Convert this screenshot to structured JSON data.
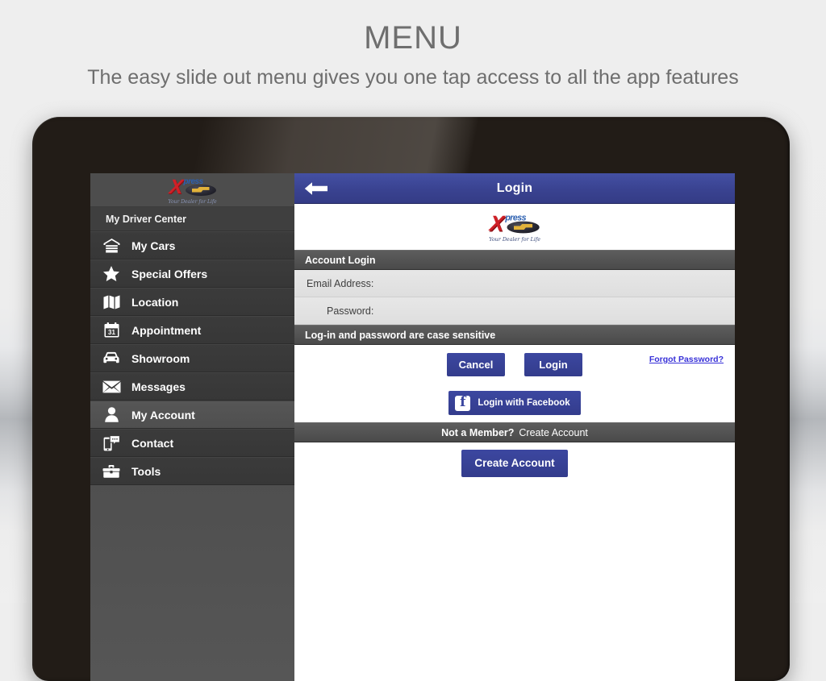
{
  "headline": {
    "title": "MENU",
    "subtitle": "The easy slide out menu gives you one tap access to all the app features"
  },
  "brand": {
    "logo_x": "X",
    "logo_word": "press",
    "logo_tagline": "Your Dealer for Life",
    "accent_blue": "#3a4391",
    "accent_red": "#cf2027",
    "link_blue": "#3730d8"
  },
  "sidebar": {
    "header_label": "My Driver Center",
    "items": [
      {
        "label": "My Cars",
        "icon": "garage-icon",
        "selected": false
      },
      {
        "label": "Special Offers",
        "icon": "star-icon",
        "selected": false
      },
      {
        "label": "Location",
        "icon": "map-icon",
        "selected": false
      },
      {
        "label": "Appointment",
        "icon": "calendar-icon",
        "selected": false
      },
      {
        "label": "Showroom",
        "icon": "car-icon",
        "selected": false
      },
      {
        "label": "Messages",
        "icon": "envelope-icon",
        "selected": false
      },
      {
        "label": "My Account",
        "icon": "person-icon",
        "selected": true
      },
      {
        "label": "Contact",
        "icon": "phone-chat-icon",
        "selected": false
      },
      {
        "label": "Tools",
        "icon": "toolbox-icon",
        "selected": false
      }
    ]
  },
  "app": {
    "back_icon": "back-arrow-icon",
    "title": "Login",
    "section_account_login": "Account Login",
    "fields": {
      "email_label": "Email Address:",
      "email_value": "",
      "email_placeholder": "",
      "password_label": "Password:",
      "password_value": "",
      "password_placeholder": ""
    },
    "case_sensitive_note": "Log-in and password are case sensitive",
    "buttons": {
      "cancel": "Cancel",
      "login": "Login",
      "facebook": "Login with Facebook",
      "create_account": "Create Account"
    },
    "forgot_password": "Forgot Password?",
    "member_bar": {
      "bold": "Not a Member?",
      "regular": "Create Account"
    }
  }
}
